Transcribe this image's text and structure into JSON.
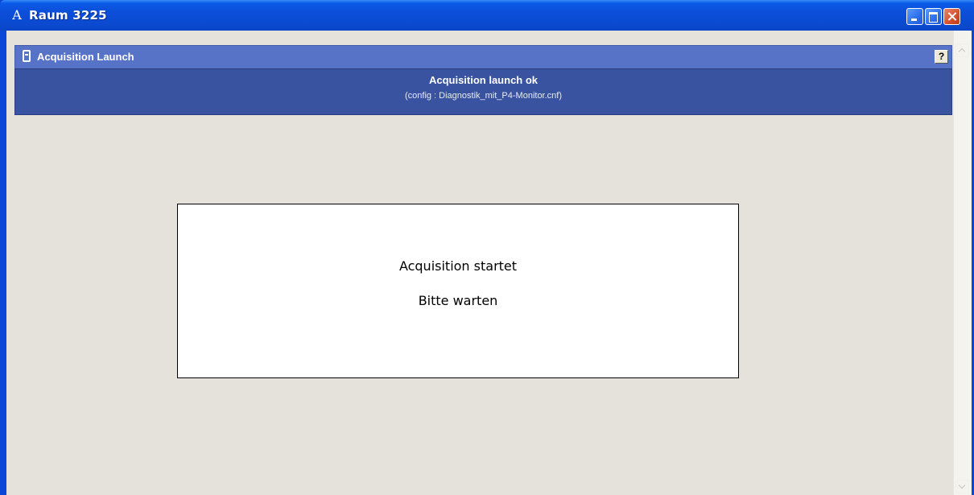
{
  "window": {
    "title": "Raum 3225",
    "app_icon_glyph": "A",
    "controls": {
      "minimize": "minimize-icon",
      "maximize": "maximize-icon",
      "close": "close-icon"
    },
    "accent_color": "#0A47D6"
  },
  "panel": {
    "title": "Acquisition Launch",
    "help_label": "?",
    "status_title": "Acquisition launch ok",
    "status_subtitle": "(config : Diagnostik_mit_P4-Monitor.cnf)",
    "header_color": "#5673C7",
    "body_color": "#3A53A0"
  },
  "message": {
    "line1": "Acquisition startet",
    "line2": "Bitte warten"
  },
  "scrollbar": {
    "up_icon": "scroll-up-icon",
    "down_icon": "scroll-down-icon"
  }
}
